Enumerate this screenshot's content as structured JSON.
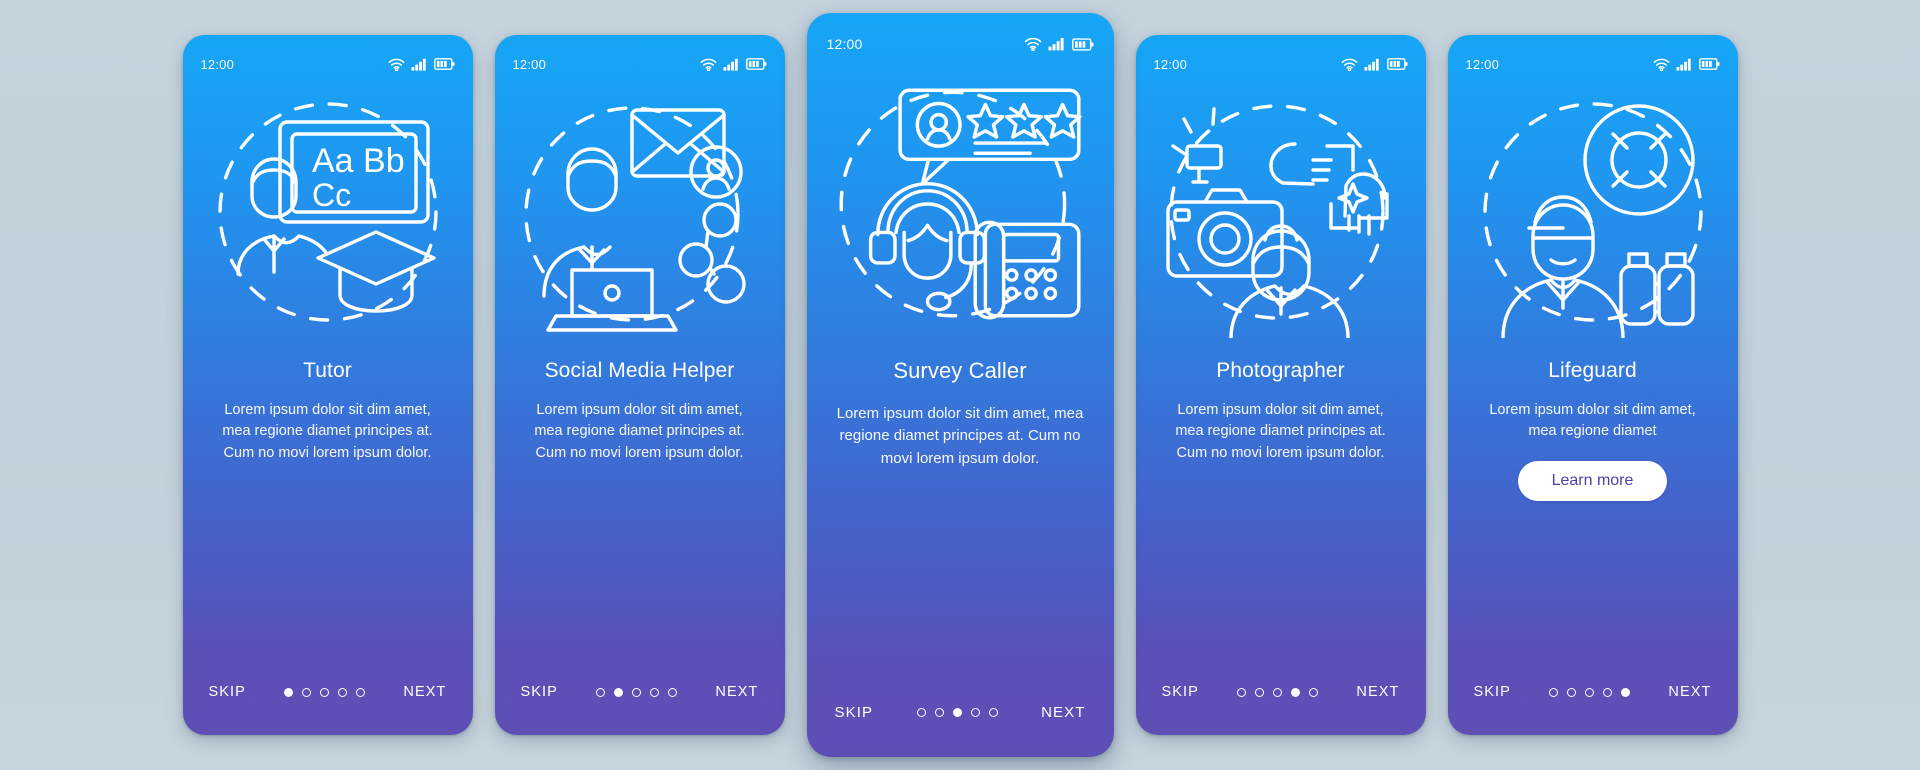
{
  "background_color": "#c3d2dc",
  "card_gradient": {
    "top": "#16a6f5",
    "bottom": "#5f4fb5"
  },
  "status_bar": {
    "time": "12:00",
    "icons": [
      "wifi-icon",
      "cellular-signal-icon",
      "battery-icon"
    ]
  },
  "nav": {
    "skip_label": "SKIP",
    "next_label": "NEXT",
    "total_dots": 5
  },
  "screens": [
    {
      "id": "tutor",
      "illustration": "tutor-blackboard-graduation-cap-icon",
      "title": "Tutor",
      "description": "Lorem ipsum dolor sit dim amet, mea regione diamet principes at. Cum no movi lorem ipsum dolor.",
      "active_dot": 1,
      "cta": null,
      "board_text_line1": "Aa Bb",
      "board_text_line2": "Cc"
    },
    {
      "id": "social-media-helper",
      "illustration": "person-laptop-envelope-share-network-icon",
      "title": "Social Media Helper",
      "description": "Lorem ipsum dolor sit dim amet, mea regione diamet principes at. Cum no movi lorem ipsum dolor.",
      "active_dot": 2,
      "cta": null
    },
    {
      "id": "survey-caller",
      "illustration": "headset-operator-desk-phone-review-icon",
      "title": "Survey Caller",
      "description": "Lorem ipsum dolor sit dim amet, mea regione diamet principes at. Cum no movi lorem ipsum dolor.",
      "active_dot": 3,
      "cta": null,
      "stars": 3
    },
    {
      "id": "photographer",
      "illustration": "camera-flash-hands-frame-photographer-icon",
      "title": "Photographer",
      "description": "Lorem ipsum dolor sit dim amet, mea regione diamet principes at. Cum no movi lorem ipsum dolor.",
      "active_dot": 4,
      "cta": null
    },
    {
      "id": "lifeguard",
      "illustration": "lifeguard-lifebuoy-binoculars-icon",
      "title": "Lifeguard",
      "description": "Lorem ipsum dolor sit dim amet, mea regione diamet",
      "active_dot": 5,
      "cta": "Learn more",
      "cta_text_color": "#4e3fa6"
    }
  ]
}
